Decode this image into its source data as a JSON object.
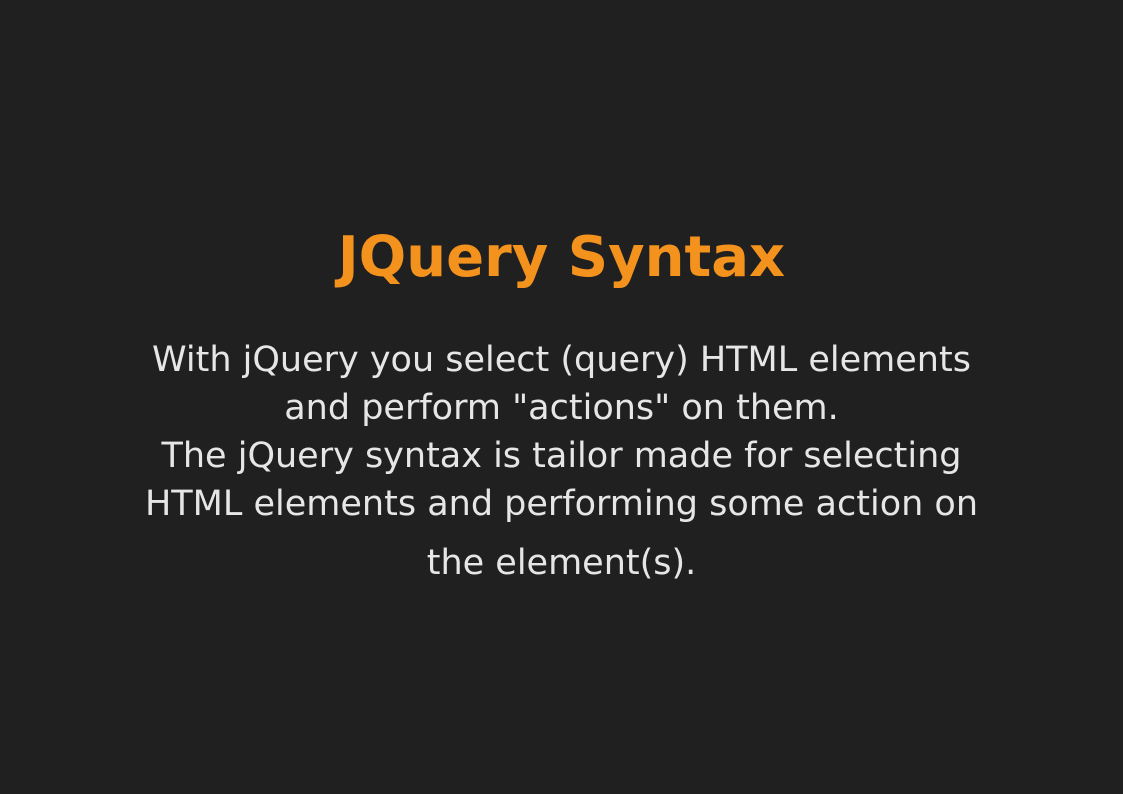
{
  "slide": {
    "title": "JQuery Syntax",
    "body_lines": [
      "With jQuery you select (query) HTML elements",
      "and perform \"actions\" on them.",
      "The jQuery syntax is tailor made for selecting",
      "HTML elements and performing some action on",
      "the element(s)."
    ]
  },
  "colors": {
    "background": "#202020",
    "title": "#F4921E",
    "body_text": "#E6E6E6"
  }
}
